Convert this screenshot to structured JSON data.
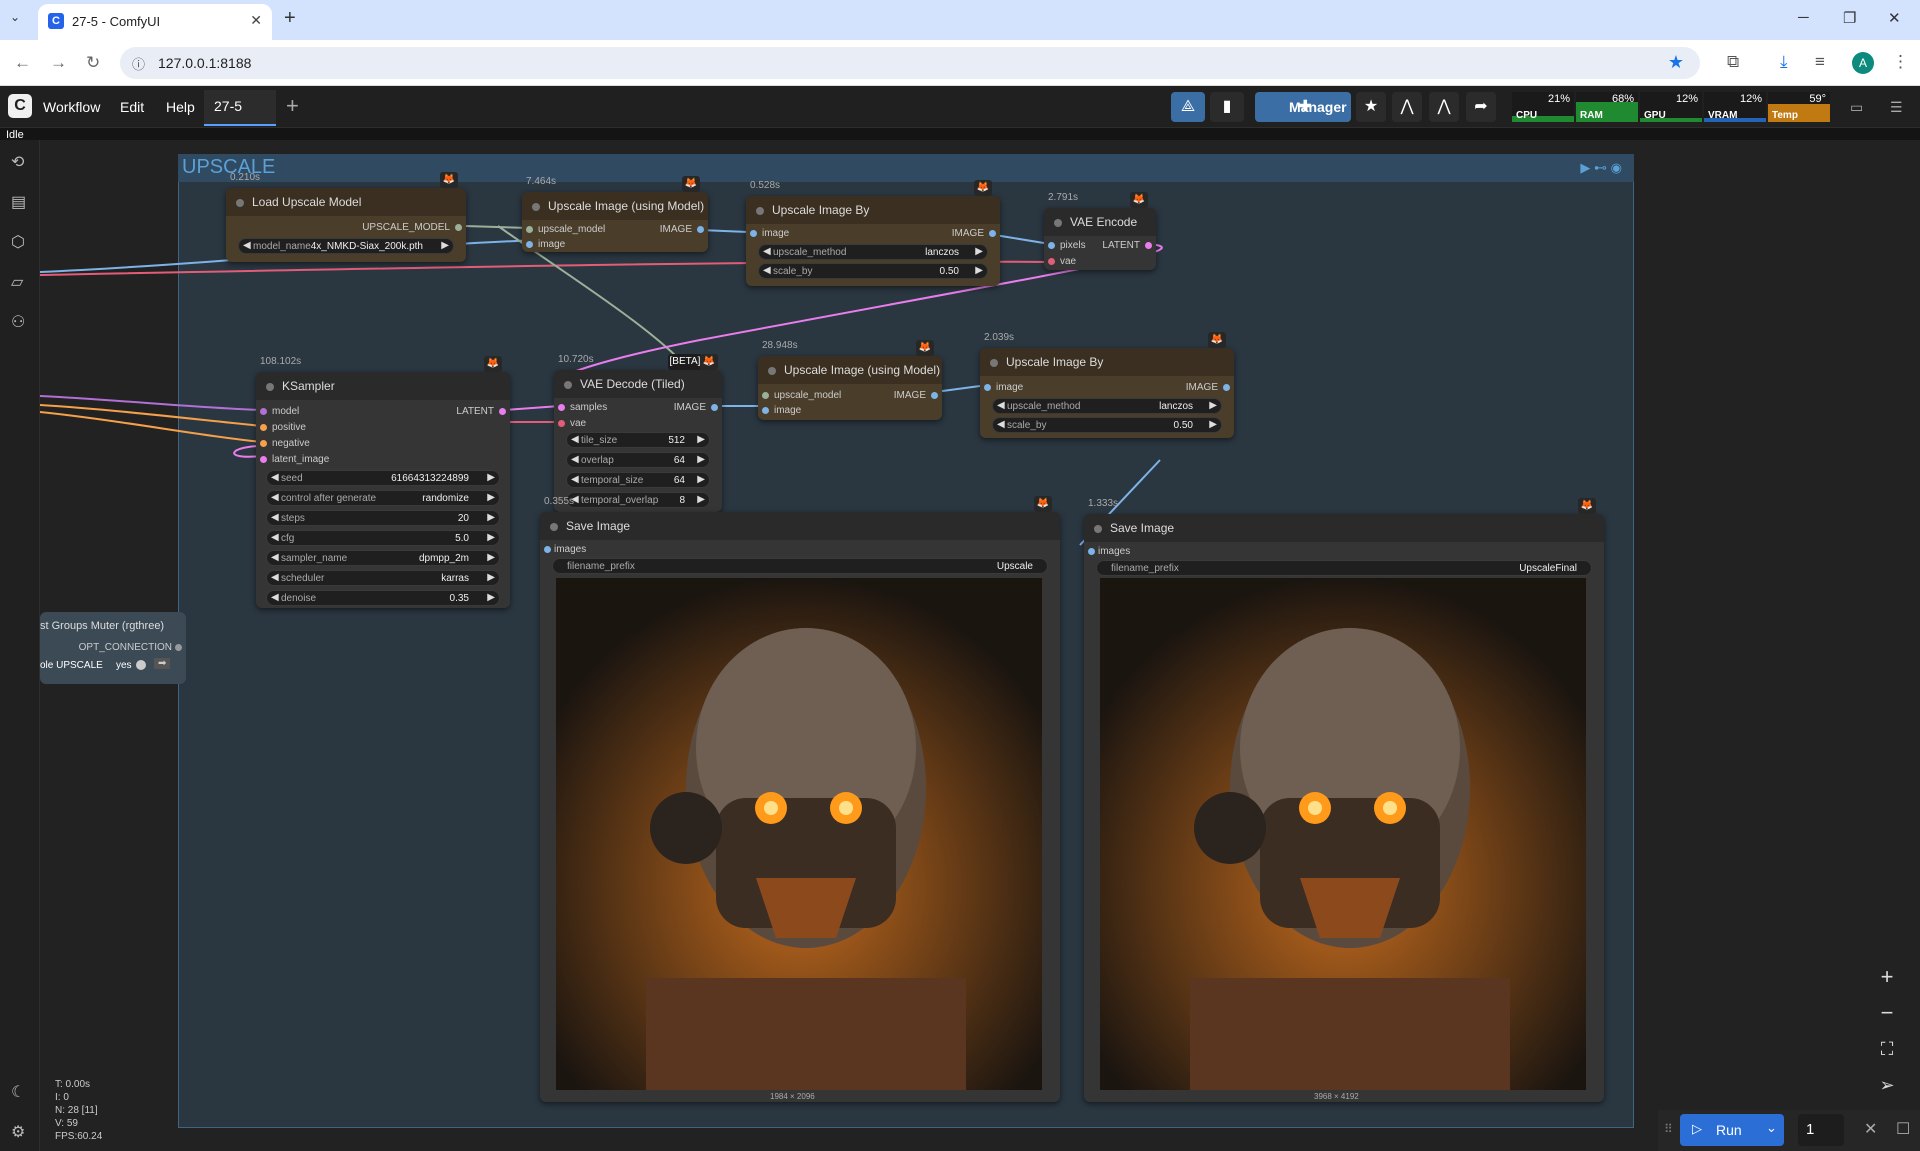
{
  "browser": {
    "tab_title": "27-5 - ComfyUI",
    "url": "127.0.0.1:8188",
    "avatar_letter": "A"
  },
  "menu": {
    "items": [
      "Workflow",
      "Edit",
      "Help"
    ],
    "workflow_tab": "27-5",
    "manager_label": "Manager",
    "status": "Idle"
  },
  "meters": [
    {
      "label": "CPU",
      "value": "21%",
      "fraction": 0.21,
      "color": "#1f8a2f"
    },
    {
      "label": "RAM",
      "value": "68%",
      "fraction": 0.68,
      "color": "#1f8a2f"
    },
    {
      "label": "GPU",
      "value": "12%",
      "fraction": 0.12,
      "color": "#1f8a2f"
    },
    {
      "label": "VRAM",
      "value": "12%",
      "fraction": 0.12,
      "color": "#2463b5"
    },
    {
      "label": "Temp",
      "value": "59°",
      "fraction": 0.59,
      "color": "#c17a12"
    }
  ],
  "group": {
    "title": "UPSCALE"
  },
  "nodes": {
    "load_upscale": {
      "time": "0.210s",
      "title": "Load Upscale Model",
      "output": "UPSCALE_MODEL",
      "model_name_label": "model_name",
      "model_name": "4x_NMKD-Siax_200k.pth"
    },
    "upscale_model1": {
      "time": "7.464s",
      "title": "Upscale Image (using Model)",
      "in1": "upscale_model",
      "in2": "image",
      "out": "IMAGE"
    },
    "upscale_by1": {
      "time": "0.528s",
      "title": "Upscale Image By",
      "in1": "image",
      "out": "IMAGE",
      "w1_label": "upscale_method",
      "w1": "lanczos",
      "w2_label": "scale_by",
      "w2": "0.50"
    },
    "vae_encode": {
      "time": "2.791s",
      "title": "VAE Encode",
      "in1": "pixels",
      "in2": "vae",
      "out": "LATENT"
    },
    "ksampler": {
      "time": "108.102s",
      "title": "KSampler",
      "inputs": [
        "model",
        "positive",
        "negative",
        "latent_image"
      ],
      "out": "LATENT",
      "widgets": [
        {
          "label": "seed",
          "value": "616643132248​99"
        },
        {
          "label": "control after generate",
          "value": "randomize"
        },
        {
          "label": "steps",
          "value": "20"
        },
        {
          "label": "cfg",
          "value": "5.0"
        },
        {
          "label": "sampler_name",
          "value": "dpmpp_2m"
        },
        {
          "label": "scheduler",
          "value": "karras"
        },
        {
          "label": "denoise",
          "value": "0.35"
        }
      ]
    },
    "vae_decode": {
      "time": "10.720s",
      "title": "VAE Decode (Tiled)",
      "beta": "[BETA]",
      "in1": "samples",
      "in2": "vae",
      "out": "IMAGE",
      "widgets": [
        {
          "label": "tile_size",
          "value": "512"
        },
        {
          "label": "overlap",
          "value": "64"
        },
        {
          "label": "temporal_size",
          "value": "64"
        },
        {
          "label": "temporal_overlap",
          "value": "8"
        }
      ]
    },
    "upscale_model2": {
      "time": "28.948s",
      "title": "Upscale Image (using Model)",
      "in1": "upscale_model",
      "in2": "image",
      "out": "IMAGE"
    },
    "upscale_by2": {
      "time": "2.039s",
      "title": "Upscale Image By",
      "in1": "image",
      "out": "IMAGE",
      "w1_label": "upscale_method",
      "w1": "lanczos",
      "w2_label": "scale_by",
      "w2": "0.50"
    },
    "save1": {
      "time": "0.355s",
      "title": "Save Image",
      "in1": "images",
      "prefix_label": "filename_prefix",
      "prefix": "Upscale",
      "size": "1984 × 2096"
    },
    "save2": {
      "time": "1.333s",
      "title": "Save Image",
      "in1": "images",
      "prefix_label": "filename_prefix",
      "prefix": "UpscaleFinal",
      "size": "3968 × 4192"
    },
    "muter": {
      "title": "st Groups Muter (rgthree)",
      "out": "OPT_CONNECTION",
      "toggle_label": "ole UPSCALE",
      "toggle_value": "yes"
    }
  },
  "stats": [
    "T: 0.00s",
    "I: 0",
    "N: 28 [11]",
    "V: 59",
    "FPS:60.24"
  ],
  "run": {
    "label": "Run",
    "count": "1"
  }
}
